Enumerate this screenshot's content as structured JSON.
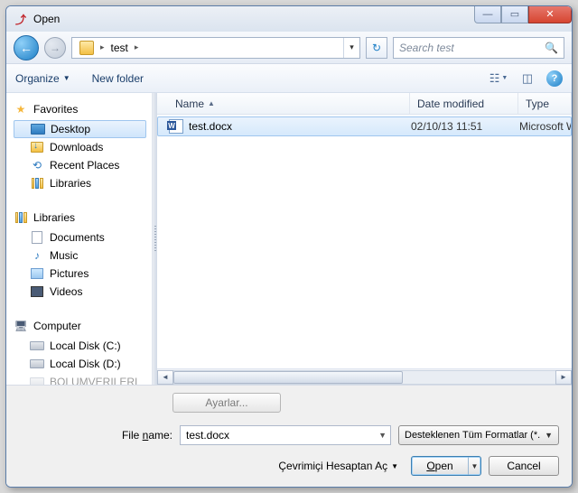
{
  "title": "Open",
  "breadcrumb": {
    "folder": "test"
  },
  "search": {
    "placeholder": "Search test"
  },
  "toolbar": {
    "organize": "Organize",
    "newfolder": "New folder"
  },
  "sidebar": {
    "favorites": {
      "label": "Favorites",
      "items": [
        {
          "label": "Desktop"
        },
        {
          "label": "Downloads"
        },
        {
          "label": "Recent Places"
        },
        {
          "label": "Libraries"
        }
      ]
    },
    "libraries": {
      "label": "Libraries",
      "items": [
        {
          "label": "Documents"
        },
        {
          "label": "Music"
        },
        {
          "label": "Pictures"
        },
        {
          "label": "Videos"
        }
      ]
    },
    "computer": {
      "label": "Computer",
      "items": [
        {
          "label": "Local Disk (C:)"
        },
        {
          "label": "Local Disk (D:)"
        },
        {
          "label": "BOLUMVERILERI"
        }
      ]
    }
  },
  "columns": {
    "name": "Name",
    "date": "Date modified",
    "type": "Type"
  },
  "files": [
    {
      "name": "test.docx",
      "date": "02/10/13 11:51",
      "type": "Microsoft W"
    }
  ],
  "bottom": {
    "ayarlar": "Ayarlar...",
    "filename_label": "File name:",
    "filename_value": "test.docx",
    "format": "Desteklenen Tüm Formatlar (*.",
    "online": "Çevrimiçi Hesaptan Aç",
    "open": "Open",
    "cancel": "Cancel"
  }
}
